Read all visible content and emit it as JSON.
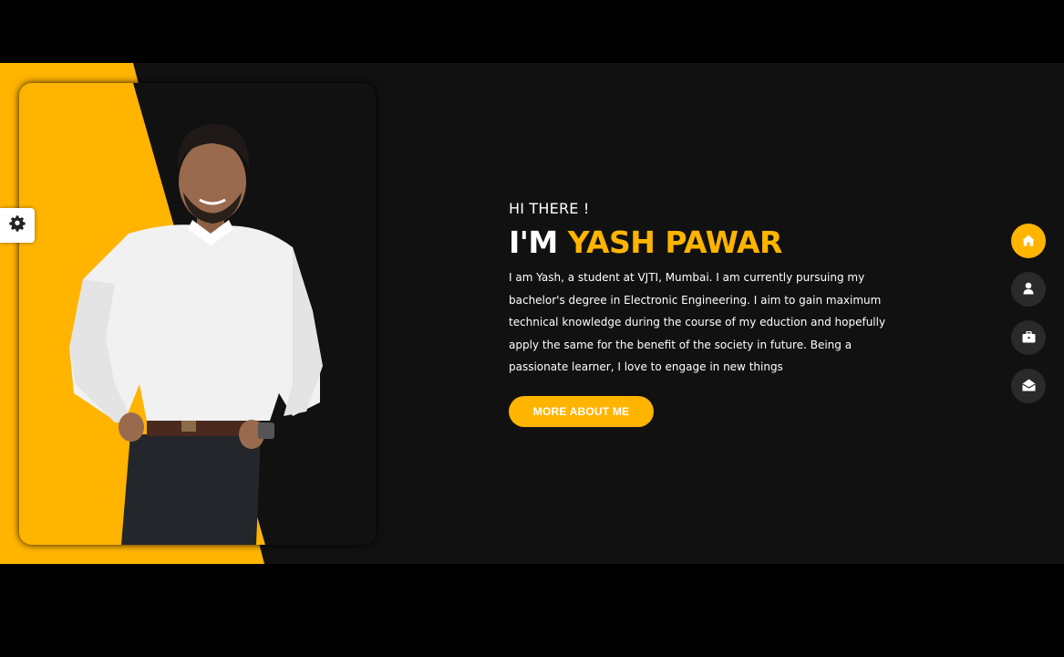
{
  "hero": {
    "greeting": "HI THERE !",
    "name_prefix": "I'M ",
    "name_highlight": "YASH PAWAR",
    "bio": "I am Yash, a student at VJTI, Mumbai. I am currently pursuing my bachelor's degree in Electronic Engineering. I aim to gain maximum technical knowledge during the course of my eduction and hopefully apply the same for the benefit of the society in future. Being a passionate learner, I love to engage in new things",
    "button_label": "MORE ABOUT ME"
  },
  "settings": {
    "icon": "gear-icon"
  },
  "side_nav": {
    "items": [
      {
        "icon": "home-icon",
        "active": true
      },
      {
        "icon": "user-icon",
        "active": false
      },
      {
        "icon": "briefcase-icon",
        "active": false
      },
      {
        "icon": "envelope-open-icon",
        "active": false
      }
    ]
  },
  "colors": {
    "accent": "#ffb400",
    "background": "#111111",
    "nav_inactive": "#2b2a2a",
    "text": "#ffffff"
  }
}
